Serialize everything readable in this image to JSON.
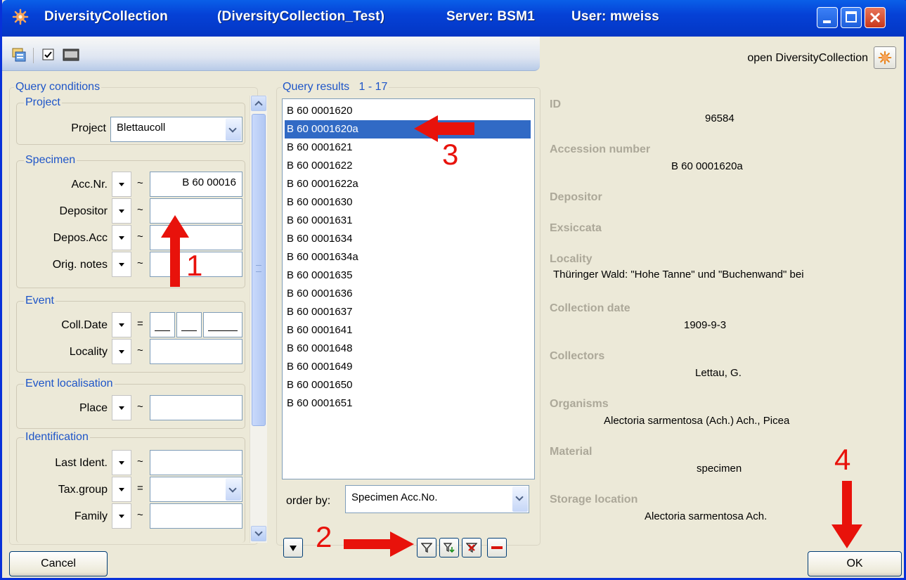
{
  "window": {
    "app_name": "DiversityCollection",
    "database": "(DiversityCollection_Test)",
    "server": "Server: BSM1",
    "user": "User: mweiss"
  },
  "header": {
    "open_label": "open DiversityCollection"
  },
  "query_conditions": {
    "title": "Query conditions",
    "groups": {
      "project": {
        "title": "Project",
        "label": "Project",
        "value": "Blettaucoll"
      },
      "specimen": {
        "title": "Specimen",
        "fields": [
          {
            "label": "Acc.Nr.",
            "op": "~",
            "value": "B 60 00016"
          },
          {
            "label": "Depositor",
            "op": "~",
            "value": ""
          },
          {
            "label": "Depos.Acc",
            "op": "~",
            "value": ""
          },
          {
            "label": "Orig. notes",
            "op": "~",
            "value": ""
          }
        ]
      },
      "event": {
        "title": "Event",
        "fields": [
          {
            "label": "Coll.Date",
            "op": "="
          },
          {
            "label": "Locality",
            "op": "~",
            "value": ""
          }
        ]
      },
      "event_localisation": {
        "title": "Event localisation",
        "fields": [
          {
            "label": "Place",
            "op": "~",
            "value": ""
          }
        ]
      },
      "identification": {
        "title": "Identification",
        "fields": [
          {
            "label": "Last Ident.",
            "op": "~",
            "value": ""
          },
          {
            "label": "Tax.group",
            "op": "=",
            "value": ""
          },
          {
            "label": "Family",
            "op": "~",
            "value": ""
          }
        ]
      }
    }
  },
  "query_results": {
    "title": "Query results",
    "range": "1 - 17",
    "items": [
      "B 60 0001620",
      "B 60 0001620a",
      "B 60 0001621",
      "B 60 0001622",
      "B 60 0001622a",
      "B 60 0001630",
      "B 60 0001631",
      "B 60 0001634",
      "B 60 0001634a",
      "B 60 0001635",
      "B 60 0001636",
      "B 60 0001637",
      "B 60 0001641",
      "B 60 0001648",
      "B 60 0001649",
      "B 60 0001650",
      "B 60 0001651"
    ],
    "selected": "B 60 0001620a",
    "order_by_label": "order by:",
    "order_by_value": "Specimen Acc.No."
  },
  "details": {
    "id_label": "ID",
    "id_value": "96584",
    "acc_label": "Accession number",
    "acc_value": "B 60 0001620a",
    "depositor_label": "Depositor",
    "exsiccata_label": "Exsiccata",
    "locality_label": "Locality",
    "locality_value": "Thüringer Wald: \"Hohe Tanne\" und \"Buchenwand\" bei",
    "colldate_label": "Collection date",
    "colldate_value": "1909-9-3",
    "collectors_label": "Collectors",
    "collectors_value": "Lettau, G.",
    "organisms_label": "Organisms",
    "organisms_value": "Alectoria sarmentosa (Ach.) Ach., Picea",
    "material_label": "Material",
    "material_value": "specimen",
    "storage_label": "Storage location",
    "storage_value": "Alectoria sarmentosa Ach."
  },
  "buttons": {
    "cancel": "Cancel",
    "ok": "OK"
  },
  "annotations": {
    "n1": "1",
    "n2": "2",
    "n3": "3",
    "n4": "4"
  },
  "colors": {
    "titlebar": "#0541d6",
    "selection": "#316ac5",
    "arrow": "#e8120b",
    "legend": "#1e55c8"
  }
}
